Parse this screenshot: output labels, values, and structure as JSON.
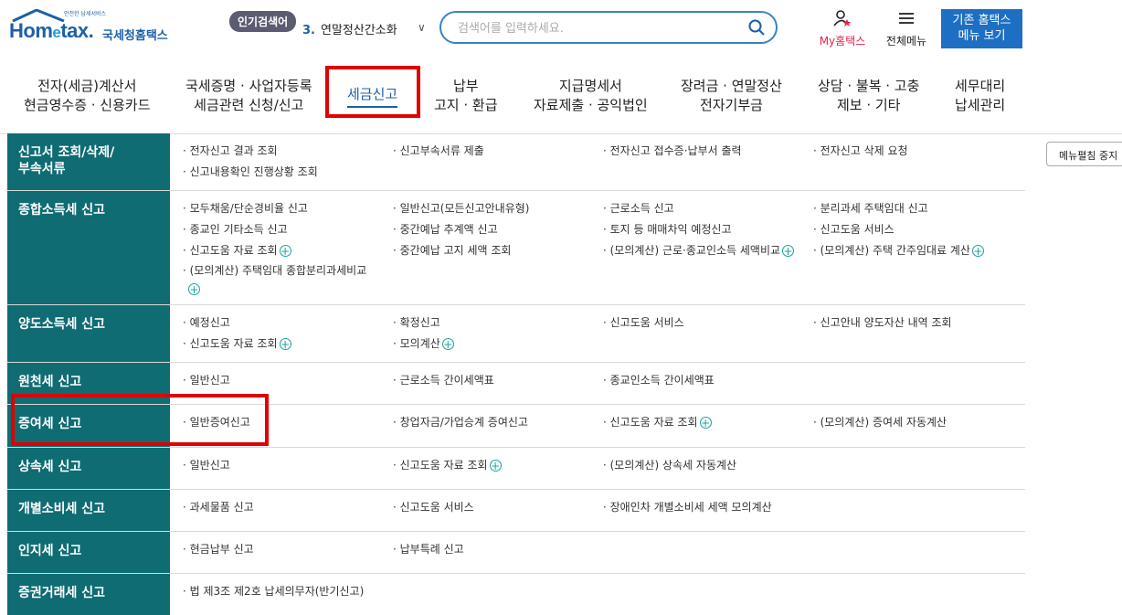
{
  "header": {
    "logo_tagline": "안전한 납세서비스",
    "logo_text": "Hometax",
    "logo_sub": "국세청홈택스",
    "popular_badge": "인기검색어",
    "popular_num": "3.",
    "popular_term": "연말정산간소화",
    "search_placeholder": "검색어를 입력하세요.",
    "my_home": "My홈택스",
    "all_menu": "전체메뉴",
    "old_line1": "기존 홈택스",
    "old_line2": "메뉴 보기"
  },
  "gnb": [
    {
      "line1": "전자(세금)계산서",
      "line2": "현금영수증 · 신용카드"
    },
    {
      "line1": "국세증명 · 사업자등록",
      "line2": "세금관련 신청/신고"
    },
    {
      "line1": "세금신고",
      "line2": ""
    },
    {
      "line1": "납부",
      "line2": "고지 · 환급"
    },
    {
      "line1": "지급명세서",
      "line2": "자료제출 · 공익법인"
    },
    {
      "line1": "장려금 · 연말정산",
      "line2": "전자기부금"
    },
    {
      "line1": "상담 · 불복 · 고충",
      "line2": "제보 · 기타"
    },
    {
      "line1": "세무대리",
      "line2": "납세관리"
    }
  ],
  "side_button": "메뉴펼침 중지",
  "rows": [
    {
      "head": "신고서 조회/삭제/부속서류",
      "items": [
        "· 전자신고 결과 조회",
        "· 신고부속서류 제출",
        "· 전자신고 접수증·납부서 출력",
        "· 전자신고 삭제 요청",
        "· 신고내용확인 진행상황 조회"
      ]
    },
    {
      "head": "종합소득세 신고",
      "items": [
        "· 모두채움/단순경비율 신고",
        "· 일반신고(모든신고안내유형)",
        "· 근로소득 신고",
        "· 분리과세 주택임대 신고",
        "· 종교인 기타소득 신고",
        "· 중간예납 추계액 신고",
        "· 토지 등 매매차익 예정신고",
        "· 신고도움 서비스",
        "· 신고도움 자료 조회",
        "· 중간예납 고지 세액 조회",
        "· (모의계산) 근로·종교인소득 세액비교",
        "· (모의계산) 주택 간주임대료 계산",
        "· (모의계산) 주택임대 종합분리과세비교"
      ]
    },
    {
      "head": "양도소득세 신고",
      "items": [
        "· 예정신고",
        "· 확정신고",
        "· 신고도움 서비스",
        "· 신고안내 양도자산 내역 조회",
        "· 신고도움 자료 조회",
        "· 모의계산"
      ]
    },
    {
      "head": "원천세 신고",
      "items": [
        "· 일반신고",
        "· 근로소득 간이세액표",
        "· 종교인소득 간이세액표"
      ]
    },
    {
      "head": "증여세 신고",
      "items": [
        "· 일반증여신고",
        "· 창업자금/가업승계 증여신고",
        "· 신고도움 자료 조회",
        "· (모의계산) 증여세 자동계산"
      ]
    },
    {
      "head": "상속세 신고",
      "items": [
        "· 일반신고",
        "· 신고도움 자료 조회",
        "· (모의계산) 상속세 자동계산"
      ]
    },
    {
      "head": "개별소비세 신고",
      "items": [
        "· 과세물품 신고",
        "· 신고도움 서비스",
        "· 장애인차 개별소비세 세액 모의계산"
      ]
    },
    {
      "head": "인지세 신고",
      "items": [
        "· 현금납부 신고",
        "· 납부특례 신고"
      ]
    },
    {
      "head": "증권거래세 신고",
      "items": [
        "· 법 제3조 제2호 납세의무자(반기신고)"
      ]
    }
  ],
  "accent_color": "#0f6c73",
  "highlight_color": "#e00000"
}
